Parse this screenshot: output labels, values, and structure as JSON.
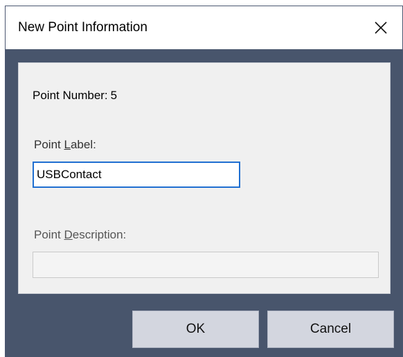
{
  "dialog": {
    "title": "New Point Information",
    "close_icon": "close-icon"
  },
  "point_number": {
    "label": "Point Number:",
    "value": "5"
  },
  "point_label": {
    "label_prefix": "Point ",
    "label_underlined": "L",
    "label_suffix": "abel:",
    "value": "USBContact"
  },
  "point_description": {
    "label_prefix": "Point ",
    "label_underlined": "D",
    "label_suffix": "escription:",
    "value": ""
  },
  "buttons": {
    "ok": "OK",
    "cancel": "Cancel"
  },
  "colors": {
    "dialog_background": "#48556c",
    "panel_background": "#f0f0f0",
    "focus_border": "#1f6fd1",
    "button_background": "#d3d6df"
  }
}
